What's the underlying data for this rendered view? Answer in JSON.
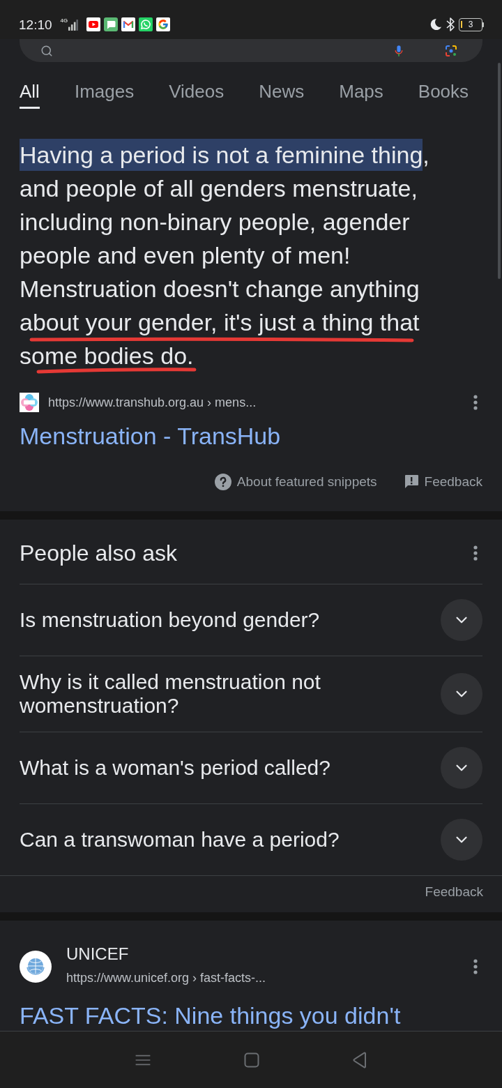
{
  "status_bar": {
    "time": "12:10",
    "network": "4G",
    "battery": "3"
  },
  "tabs": [
    {
      "label": "All",
      "selected": true
    },
    {
      "label": "Images",
      "selected": false
    },
    {
      "label": "Videos",
      "selected": false
    },
    {
      "label": "News",
      "selected": false
    },
    {
      "label": "Maps",
      "selected": false
    },
    {
      "label": "Books",
      "selected": false
    }
  ],
  "featured_snippet": {
    "highlight": "Having a period is not a feminine thing",
    "text": ", and people of all genders menstruate, including non-binary people, agender people and even plenty of men! Menstruation doesn't change anything about your gender, it's just a thing that some bodies do.",
    "url": "https://www.transhub.org.au › mens...",
    "title": "Menstruation - TransHub",
    "about": "About featured snippets",
    "feedback": "Feedback"
  },
  "people_also_ask": {
    "title": "People also ask",
    "questions": [
      {
        "text": "Is menstruation beyond gender?",
        "expanded": false
      },
      {
        "text": "Why is it called menstruation not womenstruation?",
        "expanded": false
      },
      {
        "text": "What is a woman's period called?",
        "expanded": false
      },
      {
        "text": "Can a transwoman have a period?",
        "expanded": false
      }
    ],
    "feedback": "Feedback"
  },
  "results": [
    {
      "site": "UNICEF",
      "url": "https://www.unicef.org › fast-facts-...",
      "title": "FAST FACTS: Nine things you didn't"
    }
  ]
}
